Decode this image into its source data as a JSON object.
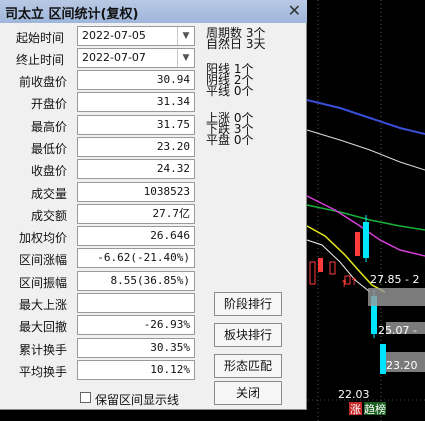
{
  "dialog": {
    "title": "司太立 区间统计(复权)",
    "close_glyph": "✕",
    "start_label": "起始时间",
    "start_value": "2022-07-05",
    "end_label": "终止时间",
    "end_value": "2022-07-07",
    "period": {
      "line1": "周期数 3个",
      "line2": "自然日 3天"
    },
    "counts": {
      "yang": "阳线 1个",
      "yin": "阴线 2个",
      "flat": "平线 0个"
    },
    "moves": {
      "up": "上涨 0个",
      "down": "下跌 3个",
      "flat": "平盘 0个"
    },
    "rows": [
      {
        "label": "前收盘价",
        "value": "30.94"
      },
      {
        "label": "开盘价",
        "value": "31.34"
      },
      {
        "label": "最高价",
        "value": "31.75"
      },
      {
        "label": "最低价",
        "value": "23.20"
      },
      {
        "label": "收盘价",
        "value": "24.32"
      },
      {
        "label": "成交量",
        "value": "1038523"
      },
      {
        "label": "成交额",
        "value": "27.7亿"
      },
      {
        "label": "加权均价",
        "value": "26.646"
      },
      {
        "label": "区间涨幅",
        "value": "-6.62(-21.40%)"
      },
      {
        "label": "区间振幅",
        "value": "8.55(36.85%)"
      },
      {
        "label": "最大上涨",
        "value": ""
      },
      {
        "label": "最大回撤",
        "value": "-26.93%"
      },
      {
        "label": "累计换手",
        "value": "30.35%"
      },
      {
        "label": "平均换手",
        "value": "10.12%"
      }
    ],
    "buttons": {
      "stage_rank": "阶段排行",
      "sector_rank": "板块排行",
      "pattern_match": "形态匹配",
      "close": "关闭"
    },
    "checkbox_label": "保留区间显示线"
  },
  "chart": {
    "price_label_1": "27.85 - 2",
    "price_label_2": "25.07 -",
    "price_label_3": "23.20",
    "price_label_4": "22.03",
    "tag_zhang": "涨",
    "tag_rest": "趋榜"
  }
}
